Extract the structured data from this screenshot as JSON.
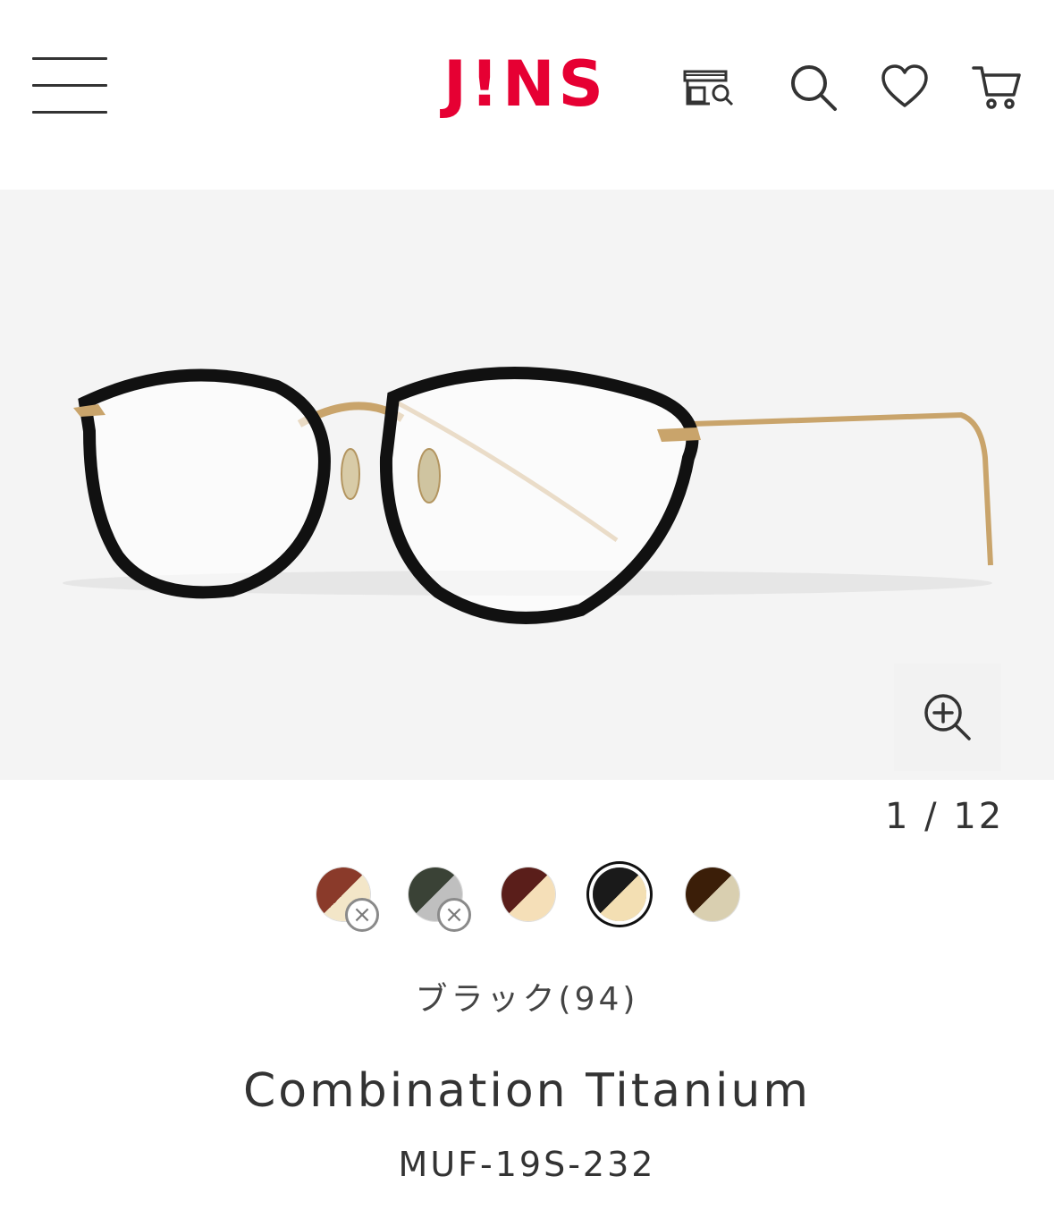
{
  "header": {
    "logo_text": "J!NS",
    "brand_color": "#e60033",
    "icons": [
      "menu-icon",
      "store-search-icon",
      "search-icon",
      "heart-icon",
      "cart-icon"
    ]
  },
  "gallery": {
    "current": "1",
    "separator": "/",
    "total": "12",
    "pager_text": "1 / 12",
    "background": "#f4f4f4"
  },
  "swatches": [
    {
      "colors": [
        "#8a3a2a",
        "#f3e6c8"
      ],
      "sold_out": true,
      "selected": false
    },
    {
      "colors": [
        "#3a4236",
        "#bfbfbf"
      ],
      "sold_out": true,
      "selected": false
    },
    {
      "colors": [
        "#5a1e1a",
        "#f5dfb8"
      ],
      "sold_out": false,
      "selected": false
    },
    {
      "colors": [
        "#1a1a1a",
        "#f3dfb3"
      ],
      "sold_out": false,
      "selected": true
    },
    {
      "colors": [
        "#3b1e08",
        "#d9cfb0"
      ],
      "sold_out": false,
      "selected": false
    }
  ],
  "product": {
    "color_label": "ブラック(94)",
    "name": "Combination Titanium",
    "code": "MUF-19S-232"
  }
}
